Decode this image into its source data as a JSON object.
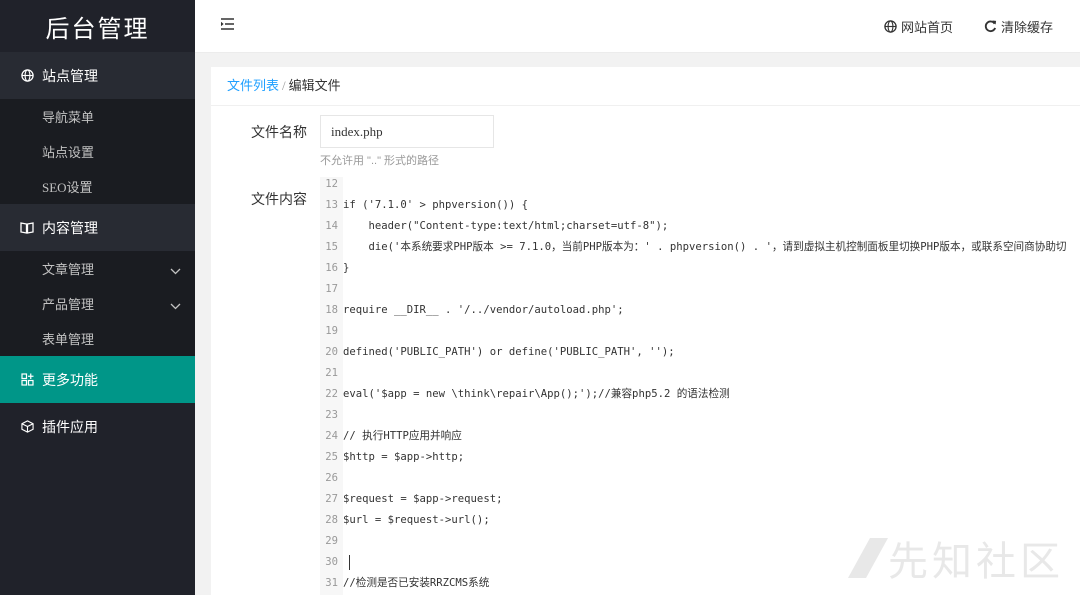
{
  "sidebar": {
    "logo": "后台管理",
    "groups": [
      {
        "label": "站点管理",
        "icon": "globe-icon"
      },
      {
        "label": "内容管理",
        "icon": "book-icon"
      },
      {
        "label": "更多功能",
        "icon": "grid-plus-icon"
      },
      {
        "label": "插件应用",
        "icon": "cube-icon"
      }
    ],
    "site_items": [
      "导航菜单",
      "站点设置",
      "SEO设置"
    ],
    "content_items": [
      "文章管理",
      "产品管理",
      "表单管理"
    ]
  },
  "header": {
    "toggle_icon": "menu-fold-icon",
    "home_link": "网站首页",
    "clear_cache": "清除缓存"
  },
  "breadcrumb": {
    "parent": "文件列表",
    "separator": "/",
    "current": "编辑文件"
  },
  "form": {
    "filename_label": "文件名称",
    "filename_value": "index.php",
    "filename_hint": "不允许用 \"..\" 形式的路径",
    "content_label": "文件内容"
  },
  "editor": {
    "lines": [
      {
        "n": "12",
        "code": ""
      },
      {
        "n": "13",
        "code": "if ('7.1.0' > phpversion()) {"
      },
      {
        "n": "14",
        "code": "    header(\"Content-type:text/html;charset=utf-8\");"
      },
      {
        "n": "15",
        "code": "    die('本系统要求PHP版本 >= 7.1.0，当前PHP版本为：' . phpversion() . '，请到虚拟主机控制面板里切换PHP版本，或联系空间商协助切"
      },
      {
        "n": "16",
        "code": "}"
      },
      {
        "n": "17",
        "code": ""
      },
      {
        "n": "18",
        "code": "require __DIR__ . '/../vendor/autoload.php';"
      },
      {
        "n": "19",
        "code": ""
      },
      {
        "n": "20",
        "code": "defined('PUBLIC_PATH') or define('PUBLIC_PATH', '');"
      },
      {
        "n": "21",
        "code": ""
      },
      {
        "n": "22",
        "code": "eval('$app = new \\think\\repair\\App();');//兼容php5.2 的语法检测"
      },
      {
        "n": "23",
        "code": ""
      },
      {
        "n": "24",
        "code": "// 执行HTTP应用并响应"
      },
      {
        "n": "25",
        "code": "$http = $app->http;"
      },
      {
        "n": "26",
        "code": ""
      },
      {
        "n": "27",
        "code": "$request = $app->request;"
      },
      {
        "n": "28",
        "code": "$url = $request->url();"
      },
      {
        "n": "29",
        "code": ""
      },
      {
        "n": "30",
        "code": ""
      },
      {
        "n": "31",
        "code": "//检测是否已安装RRZCMS系统"
      }
    ]
  },
  "watermark": "先知社区"
}
